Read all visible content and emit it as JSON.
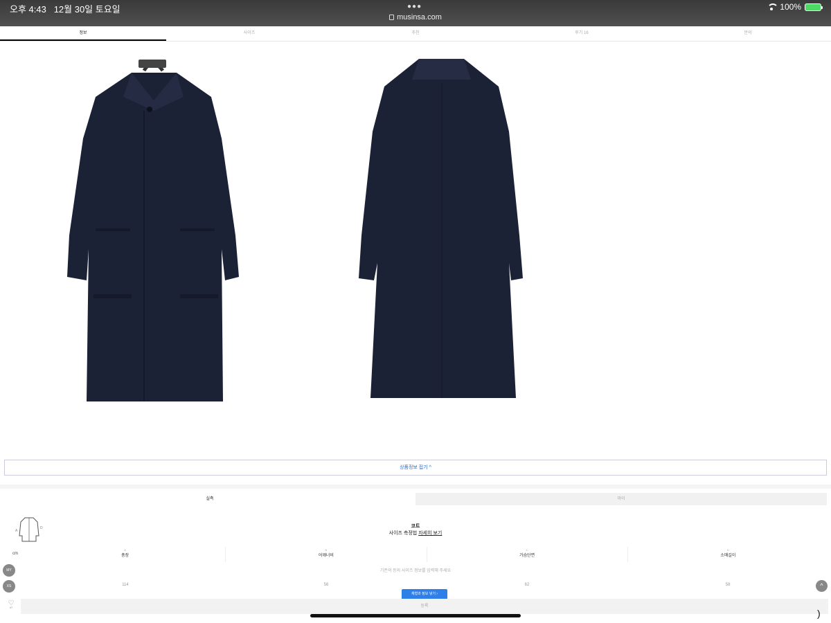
{
  "status_bar": {
    "time": "오후 4:43",
    "date": "12월 30일 토요일",
    "url": "musinsa.com",
    "battery": "100%"
  },
  "tabs": [
    {
      "label": "정보",
      "active": true
    },
    {
      "label": "사이즈",
      "active": false
    },
    {
      "label": "추천",
      "active": false
    },
    {
      "label": "후기",
      "badge": "16",
      "active": false
    },
    {
      "label": "문의",
      "active": false
    }
  ],
  "product": {
    "fold_button": "상품정보 접기 ^",
    "coat_color": "#1c2236"
  },
  "size_section": {
    "tabs": [
      {
        "label": "실측"
      },
      {
        "label": "마이"
      }
    ],
    "category": "코트",
    "method_prefix": "사이즈 측정법 ",
    "method_link": "자세히 보기",
    "unit": "cm",
    "columns": [
      {
        "letter": "A",
        "label": "총장"
      },
      {
        "letter": "B",
        "label": "어깨너비"
      },
      {
        "letter": "C",
        "label": "가슴단면"
      },
      {
        "letter": "D",
        "label": "소매길이"
      }
    ],
    "row_labels": [
      "MY",
      "XS"
    ],
    "notice": "기존의 등의 사이즈 정보를 입력해 주세요",
    "values": [
      "114",
      "56",
      "62",
      "58"
    ],
    "compare_button": "체형과 정보 넣기 ›",
    "bottom_label": "등록",
    "like_count": "47"
  },
  "accent_color": "#2f7fe8"
}
